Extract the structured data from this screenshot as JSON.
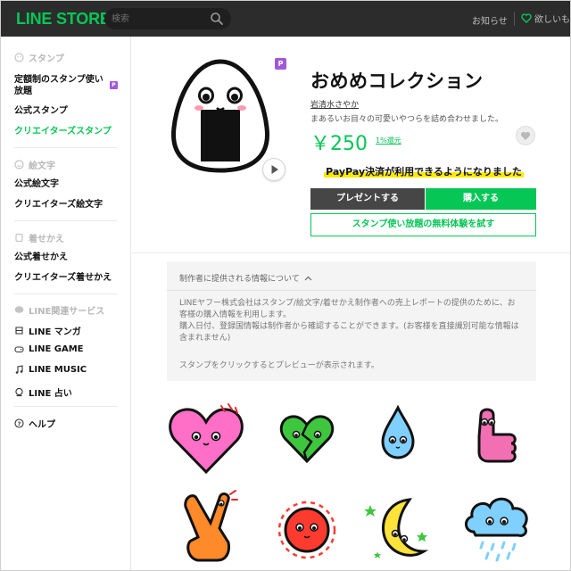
{
  "header": {
    "logo": "LINE STORE",
    "search_placeholder": "検索",
    "notice_label": "お知らせ",
    "wishlist_label": "欲しいも"
  },
  "sidebar": {
    "sticker_section": "スタンプ",
    "sticker_items": [
      "定額制のスタンプ使い放題",
      "公式スタンプ",
      "クリエイターズスタンプ"
    ],
    "sticker_sub_label_1": "定額制のスタンプ使い",
    "sticker_sub_label_2": "放題",
    "emoji_section": "絵文字",
    "emoji_items": [
      "公式絵文字",
      "クリエイターズ絵文字"
    ],
    "theme_section": "着せかえ",
    "theme_items": [
      "公式着せかえ",
      "クリエイターズ着せかえ"
    ],
    "services_section": "LINE関連サービス",
    "services": [
      "LINE マンガ",
      "LINE GAME",
      "LINE MUSIC",
      "LINE 占い"
    ],
    "help": "ヘルプ",
    "badge": "P"
  },
  "product": {
    "badge": "P",
    "title": "おめめコレクション",
    "author": "岩清水さやか",
    "description": "まあるいお目々の可愛いやつらを詰め合わせました。",
    "price": "￥250",
    "refund": "1%還元",
    "paypay_notice": "PayPay決済が利用できるようになりました",
    "gift_button": "プレゼントする",
    "buy_button": "購入する",
    "trial_button": "スタンプ使い放題の無料体験を試す"
  },
  "info": {
    "heading": "制作者に提供される情報について",
    "line1": "LINEヤフー株式会社はスタンプ/絵文字/着せかえ制作者への売上レポートの提供のために、お",
    "line2": "客様の購入情報を利用します。",
    "line3": "購入日付、登録国情報は制作者から確認することができます。(お客様を直接識別可能な情報は",
    "line4": "含まれません)",
    "preview_hint": "スタンプをクリックするとプレビューが表示されます。"
  },
  "colors": {
    "brand_green": "#06c755",
    "header_bg": "#2c2c2c",
    "premium_purple": "#a05ad8"
  },
  "stickers": [
    {
      "name": "pink-heart"
    },
    {
      "name": "broken-green-heart"
    },
    {
      "name": "blue-drop"
    },
    {
      "name": "pink-thumbs-up"
    },
    {
      "name": "orange-peace-hand"
    },
    {
      "name": "red-sun"
    },
    {
      "name": "yellow-moon"
    },
    {
      "name": "crying-cloud"
    }
  ]
}
